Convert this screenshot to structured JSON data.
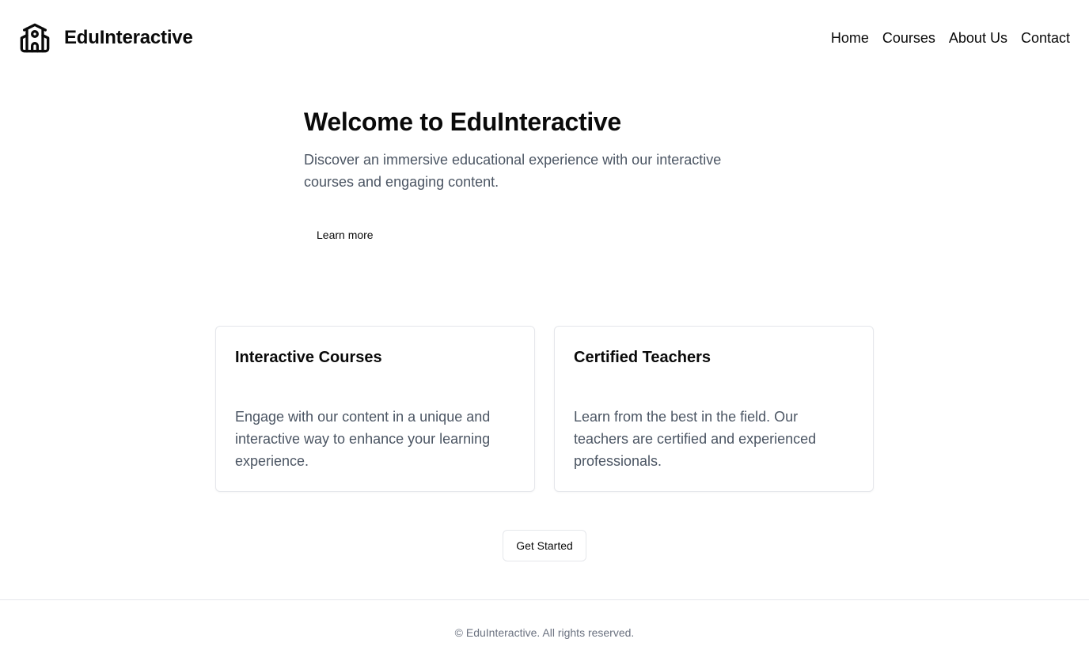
{
  "header": {
    "brand_name": "EduInteractive",
    "brand_icon": "school-icon",
    "nav": [
      {
        "label": "Home"
      },
      {
        "label": "Courses"
      },
      {
        "label": "About Us"
      },
      {
        "label": "Contact"
      }
    ]
  },
  "hero": {
    "title": "Welcome to EduInteractive",
    "description": "Discover an immersive educational experience with our interactive courses and engaging content.",
    "learn_more_label": "Learn more"
  },
  "features": [
    {
      "title": "Interactive Courses",
      "description": "Engage with our content in a unique and interactive way to enhance your learning experience."
    },
    {
      "title": "Certified Teachers",
      "description": "Learn from the best in the field. Our teachers are certified and experienced professionals."
    }
  ],
  "cta": {
    "label": "Get Started"
  },
  "footer": {
    "text": "© EduInteractive. All rights reserved."
  },
  "colors": {
    "text": "#0a0a0a",
    "muted_text": "#4b5563",
    "footer_text": "#6b7280",
    "border": "#e5e7eb",
    "background": "#ffffff"
  }
}
